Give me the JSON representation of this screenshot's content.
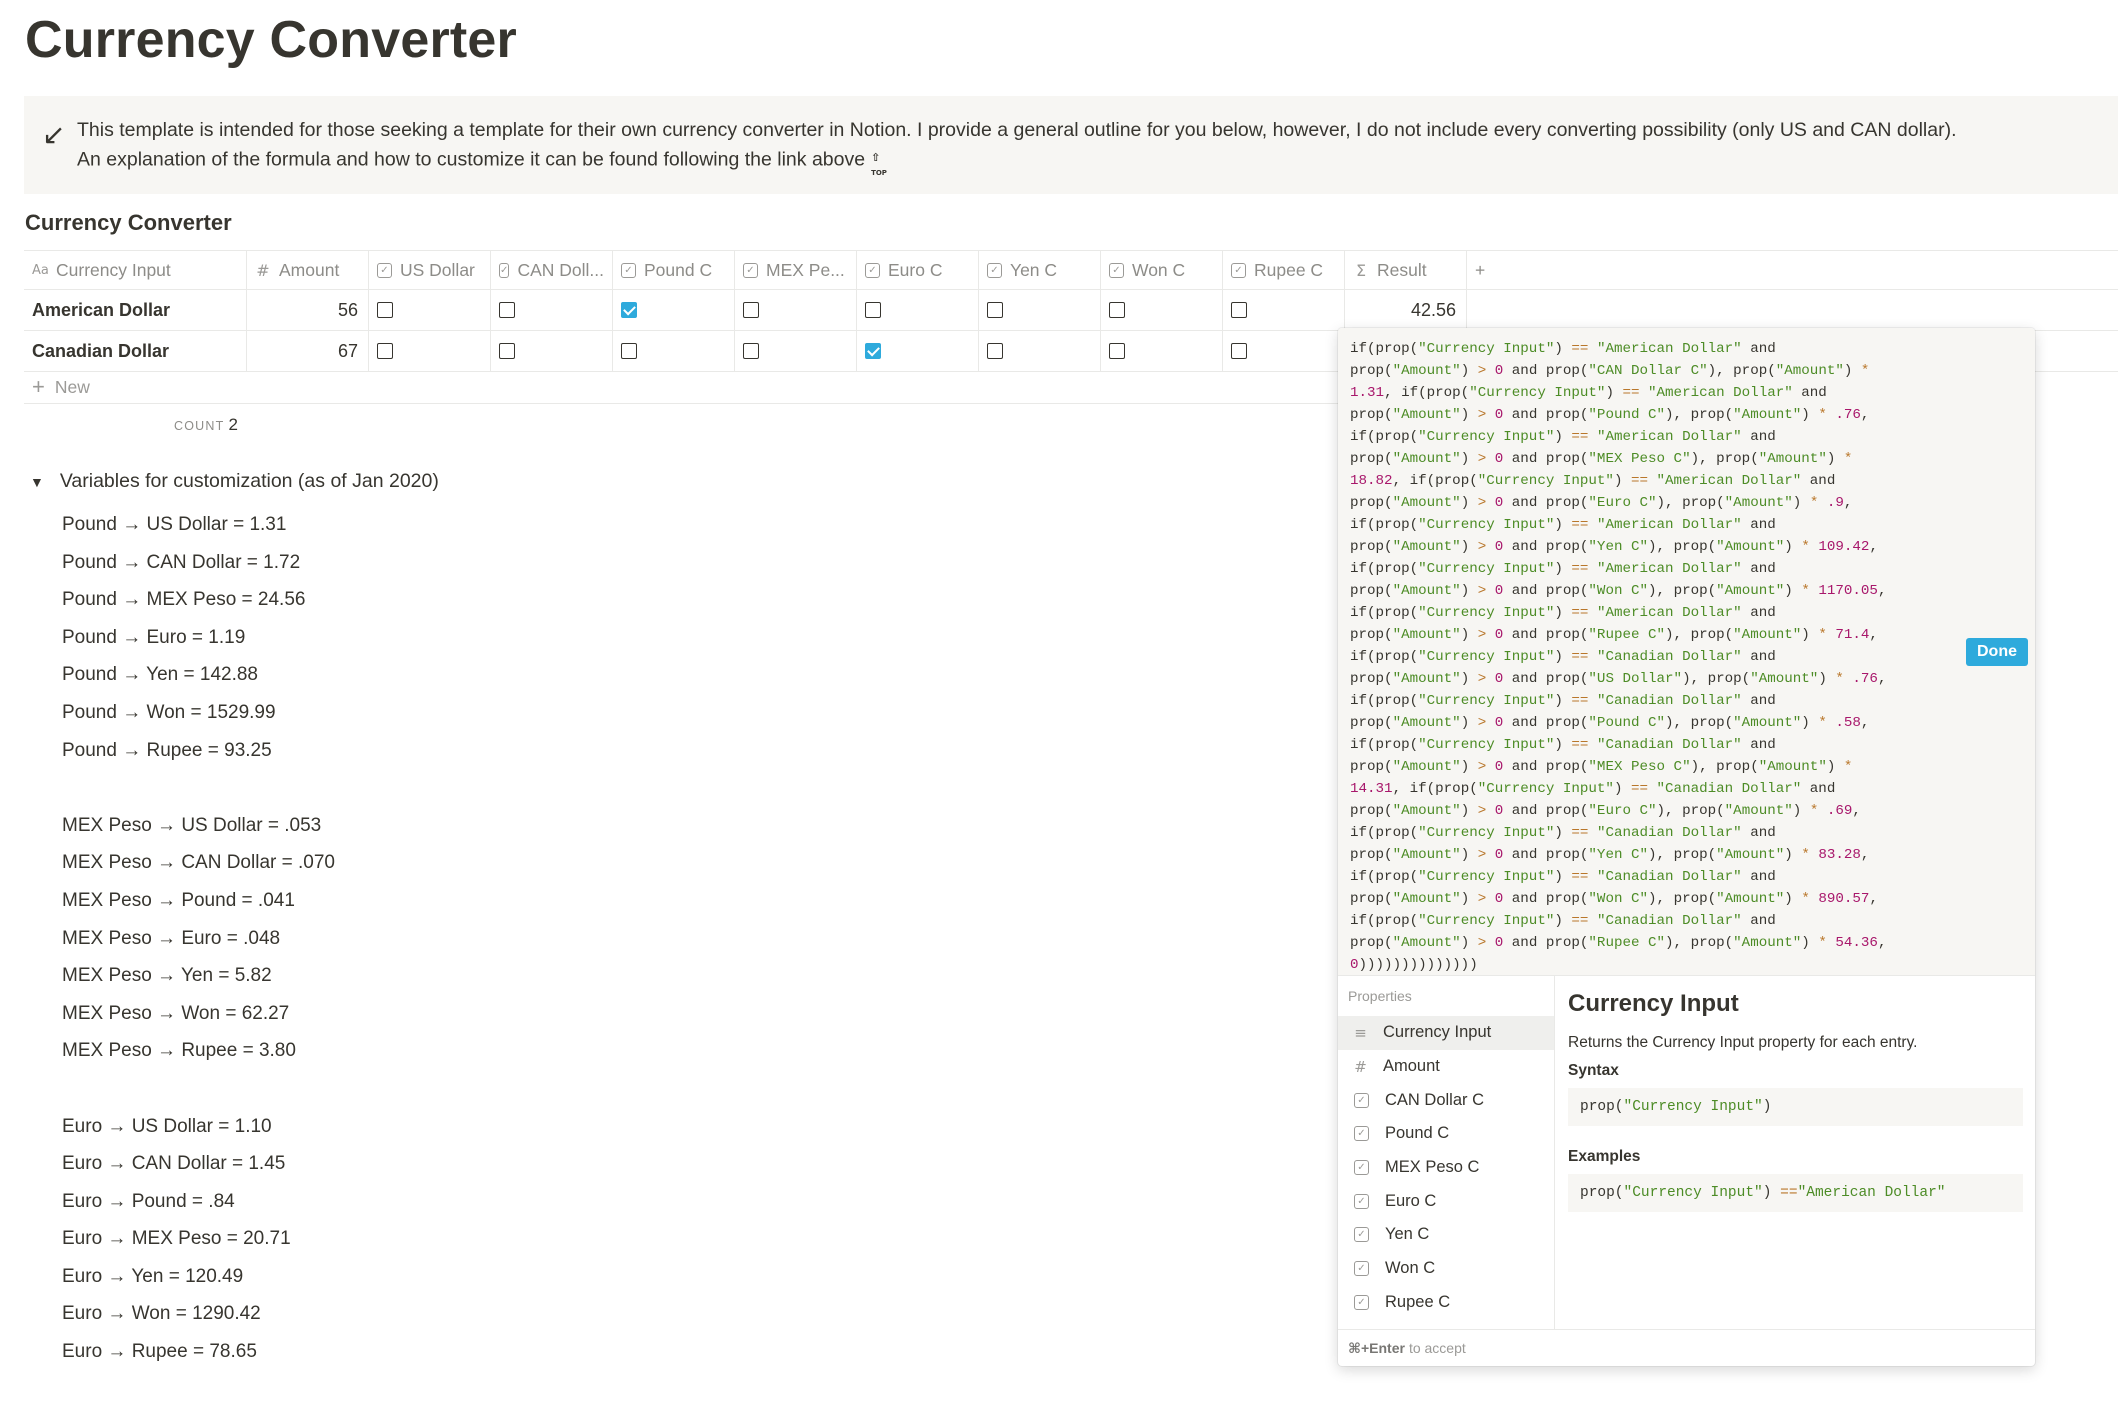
{
  "page": {
    "title": "Currency Converter"
  },
  "callout": {
    "icon": "arrow-down-left-icon",
    "line1": "This template is intended for those seeking a template for their own currency converter in Notion. I provide a general outline for you below, however, I do not include every converting possibility (only US and CAN dollar).",
    "line2": "An explanation of the formula and how to customize it can be found following the link above",
    "badge": "TOP"
  },
  "database": {
    "title": "Currency Converter",
    "columns": [
      {
        "label": "Currency Input",
        "icon": "text-aa-icon"
      },
      {
        "label": "Amount",
        "icon": "number-hash-icon"
      },
      {
        "label": "US Dollar",
        "icon": "checkbox-icon"
      },
      {
        "label": "CAN Doll...",
        "icon": "checkbox-icon"
      },
      {
        "label": "Pound C",
        "icon": "checkbox-icon"
      },
      {
        "label": "MEX Pe...",
        "icon": "checkbox-icon"
      },
      {
        "label": "Euro C",
        "icon": "checkbox-icon"
      },
      {
        "label": "Yen C",
        "icon": "checkbox-icon"
      },
      {
        "label": "Won C",
        "icon": "checkbox-icon"
      },
      {
        "label": "Rupee C",
        "icon": "checkbox-icon"
      },
      {
        "label": "Result",
        "icon": "sigma-formula-icon"
      }
    ],
    "rows": [
      {
        "name": "American Dollar",
        "amount": "56",
        "checks": [
          false,
          false,
          true,
          false,
          false,
          false,
          false,
          false
        ],
        "result": "42.56"
      },
      {
        "name": "Canadian Dollar",
        "amount": "67",
        "checks": [
          false,
          false,
          false,
          false,
          true,
          false,
          false,
          false
        ],
        "result": ""
      }
    ],
    "new_label": "New",
    "count_label": "COUNT",
    "count_value": "2"
  },
  "toggle": {
    "label": "Variables for customization (as of Jan 2020)",
    "items": [
      "Pound → US Dollar = 1.31",
      "Pound → CAN Dollar = 1.72",
      "Pound → MEX Peso = 24.56",
      "Pound → Euro = 1.19",
      "Pound → Yen = 142.88",
      "Pound → Won = 1529.99",
      "Pound → Rupee = 93.25",
      "",
      "MEX Peso → US Dollar = .053",
      "MEX Peso → CAN Dollar = .070",
      "MEX Peso → Pound = .041",
      "MEX Peso → Euro = .048",
      "MEX Peso → Yen = 5.82",
      "MEX Peso → Won = 62.27",
      "MEX Peso → Rupee = 3.80",
      "",
      "Euro → US Dollar = 1.10",
      "Euro → CAN Dollar = 1.45",
      "Euro → Pound = .84",
      "Euro → MEX Peso = 20.71",
      "Euro → Yen = 120.49",
      "Euro → Won = 1290.42",
      "Euro → Rupee = 78.65"
    ]
  },
  "formula": {
    "lines": [
      "if(prop(\"Currency Input\") == \"American Dollar\" and",
      "prop(\"Amount\") > 0 and prop(\"CAN Dollar C\"), prop(\"Amount\") *",
      "1.31, if(prop(\"Currency Input\") == \"American Dollar\" and",
      "prop(\"Amount\") > 0 and prop(\"Pound C\"), prop(\"Amount\") * .76,",
      "if(prop(\"Currency Input\") == \"American Dollar\" and",
      "prop(\"Amount\") > 0 and prop(\"MEX Peso C\"), prop(\"Amount\") *",
      "18.82, if(prop(\"Currency Input\") == \"American Dollar\" and",
      "prop(\"Amount\") > 0 and prop(\"Euro C\"), prop(\"Amount\") * .9,",
      "if(prop(\"Currency Input\") == \"American Dollar\" and",
      "prop(\"Amount\") > 0 and prop(\"Yen C\"), prop(\"Amount\") * 109.42,",
      "if(prop(\"Currency Input\") == \"American Dollar\" and",
      "prop(\"Amount\") > 0 and prop(\"Won C\"), prop(\"Amount\") * 1170.05,",
      "if(prop(\"Currency Input\") == \"American Dollar\" and",
      "prop(\"Amount\") > 0 and prop(\"Rupee C\"), prop(\"Amount\") * 71.4,",
      "if(prop(\"Currency Input\") == \"Canadian Dollar\" and",
      "prop(\"Amount\") > 0 and prop(\"US Dollar\"), prop(\"Amount\") * .76,",
      "if(prop(\"Currency Input\") == \"Canadian Dollar\" and",
      "prop(\"Amount\") > 0 and prop(\"Pound C\"), prop(\"Amount\") * .58,",
      "if(prop(\"Currency Input\") == \"Canadian Dollar\" and",
      "prop(\"Amount\") > 0 and prop(\"MEX Peso C\"), prop(\"Amount\") *",
      "14.31, if(prop(\"Currency Input\") == \"Canadian Dollar\" and",
      "prop(\"Amount\") > 0 and prop(\"Euro C\"), prop(\"Amount\") * .69,",
      "if(prop(\"Currency Input\") == \"Canadian Dollar\" and",
      "prop(\"Amount\") > 0 and prop(\"Yen C\"), prop(\"Amount\") * 83.28,",
      "if(prop(\"Currency Input\") == \"Canadian Dollar\" and",
      "prop(\"Amount\") > 0 and prop(\"Won C\"), prop(\"Amount\") * 890.57,",
      "if(prop(\"Currency Input\") == \"Canadian Dollar\" and",
      "prop(\"Amount\") > 0 and prop(\"Rupee C\"), prop(\"Amount\") * 54.36,",
      "0))))))))))))))"
    ],
    "done_label": "Done",
    "properties_title": "Properties",
    "properties": [
      {
        "label": "Currency Input",
        "icon": "text-lines-icon",
        "active": true
      },
      {
        "label": "Amount",
        "icon": "number-hash-icon",
        "active": false
      },
      {
        "label": "CAN Dollar C",
        "icon": "checkbox-icon",
        "active": false
      },
      {
        "label": "Pound C",
        "icon": "checkbox-icon",
        "active": false
      },
      {
        "label": "MEX Peso C",
        "icon": "checkbox-icon",
        "active": false
      },
      {
        "label": "Euro C",
        "icon": "checkbox-icon",
        "active": false
      },
      {
        "label": "Yen C",
        "icon": "checkbox-icon",
        "active": false
      },
      {
        "label": "Won C",
        "icon": "checkbox-icon",
        "active": false
      },
      {
        "label": "Rupee C",
        "icon": "checkbox-icon",
        "active": false
      }
    ],
    "doc": {
      "title": "Currency Input",
      "description": "Returns the Currency Input property for each entry.",
      "syntax_label": "Syntax",
      "syntax": "prop(\"Currency Input\")",
      "examples_label": "Examples",
      "example": "prop(\"Currency Input\") == \"American Dollar\""
    },
    "footer_key": "⌘+Enter",
    "footer_text": "to accept"
  },
  "colors": {
    "text": "#37352f",
    "muted": "#9b9a97",
    "accent": "#2eaadc",
    "callout_bg": "#f7f6f3",
    "code_string": "#4d8c26",
    "code_operator": "#b9772b",
    "code_number": "#a8176b"
  }
}
